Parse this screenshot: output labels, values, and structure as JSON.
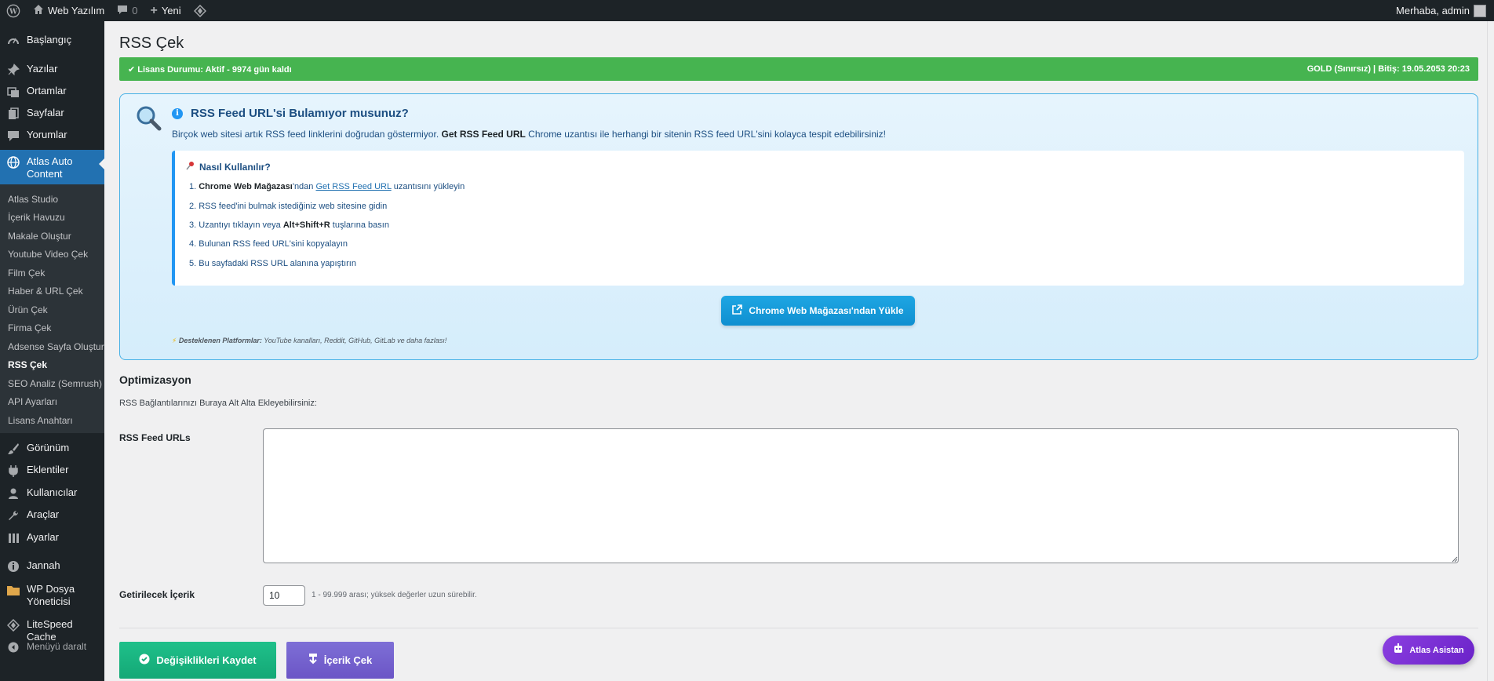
{
  "adminbar": {
    "site_name": "Web Yazılım",
    "comments_count": "0",
    "new_label": "Yeni",
    "greeting": "Merhaba, admin"
  },
  "sidebar": {
    "items": [
      {
        "label": "Başlangıç",
        "icon": "dashboard-icon"
      },
      {
        "label": "Yazılar",
        "icon": "pin-icon"
      },
      {
        "label": "Ortamlar",
        "icon": "media-icon"
      },
      {
        "label": "Sayfalar",
        "icon": "page-icon"
      },
      {
        "label": "Yorumlar",
        "icon": "comment-icon"
      },
      {
        "label": "Atlas Auto Content",
        "icon": "globe-icon"
      }
    ],
    "submenu": [
      "Atlas Studio",
      "İçerik Havuzu",
      "Makale Oluştur",
      "Youtube Video Çek",
      "Film Çek",
      "Haber & URL Çek",
      "Ürün Çek",
      "Firma Çek",
      "Adsense Sayfa Oluştur",
      "RSS Çek",
      "SEO Analiz (Semrush)",
      "API Ayarları",
      "Lisans Anahtarı"
    ],
    "items2": [
      {
        "label": "Görünüm",
        "icon": "brush-icon"
      },
      {
        "label": "Eklentiler",
        "icon": "plugin-icon"
      },
      {
        "label": "Kullanıcılar",
        "icon": "users-icon"
      },
      {
        "label": "Araçlar",
        "icon": "wrench-icon"
      },
      {
        "label": "Ayarlar",
        "icon": "settings-icon"
      },
      {
        "label": "Jannah",
        "icon": "info-icon"
      },
      {
        "label": "WP Dosya Yöneticisi",
        "icon": "folder-icon"
      },
      {
        "label": "LiteSpeed Cache",
        "icon": "diamond-icon"
      },
      {
        "label": "Menüyü daralt",
        "icon": "collapse-icon"
      }
    ]
  },
  "page": {
    "title": "RSS Çek",
    "license_left": "✔ Lisans Durumu: Aktif - 9974 gün kaldı",
    "license_right": "GOLD (Sınırsız) | Bitiş: 19.05.2053 20:23"
  },
  "info": {
    "heading": "RSS Feed URL'si Bulamıyor musunuz?",
    "desc_pre": "Birçok web sitesi artık RSS feed linklerini doğrudan göstermiyor. ",
    "desc_bold": "Get RSS Feed URL",
    "desc_post": " Chrome uzantısı ile herhangi bir sitenin RSS feed URL'sini kolayca tespit edebilirsiniz!",
    "how_title": "Nasıl Kullanılır?",
    "step1_bold": "Chrome Web Mağazası",
    "step1_mid": "'ndan ",
    "step1_link": "Get RSS Feed URL",
    "step1_post": " uzantısını yükleyin",
    "step2": "RSS feed'ini bulmak istediğiniz web sitesine gidin",
    "step3_pre": "Uzantıyı tıklayın veya ",
    "step3_bold": "Alt+Shift+R",
    "step3_post": " tuşlarına basın",
    "step4": "Bulunan RSS feed URL'sini kopyalayın",
    "step5": "Bu sayfadaki RSS URL alanına yapıştırın",
    "chrome_button": "Chrome Web Mağazası'ndan Yükle",
    "platforms_bold": "Desteklenen Platformlar:",
    "platforms_text": " YouTube kanalları, Reddit, GitHub, GitLab ve daha fazlası!"
  },
  "form": {
    "section_title": "Optimizasyon",
    "section_desc": "RSS Bağlantılarınızı Buraya Alt Alta Ekleyebilirsiniz:",
    "rss_label": "RSS Feed URLs",
    "rss_value": "",
    "count_label": "Getirilecek İçerik",
    "count_value": "10",
    "count_hint": "1 - 99.999 arası; yüksek değerler uzun sürebilir."
  },
  "buttons": {
    "save": "Değişiklikleri Kaydet",
    "fetch": "İçerik Çek",
    "assistant": "Atlas Asistan"
  },
  "colors": {
    "license_green": "#46b450",
    "wp_blue": "#2271b1",
    "save_green": "#14a876",
    "fetch_purple": "#6b55c6",
    "assistant_purple": "#7b2fd6"
  }
}
